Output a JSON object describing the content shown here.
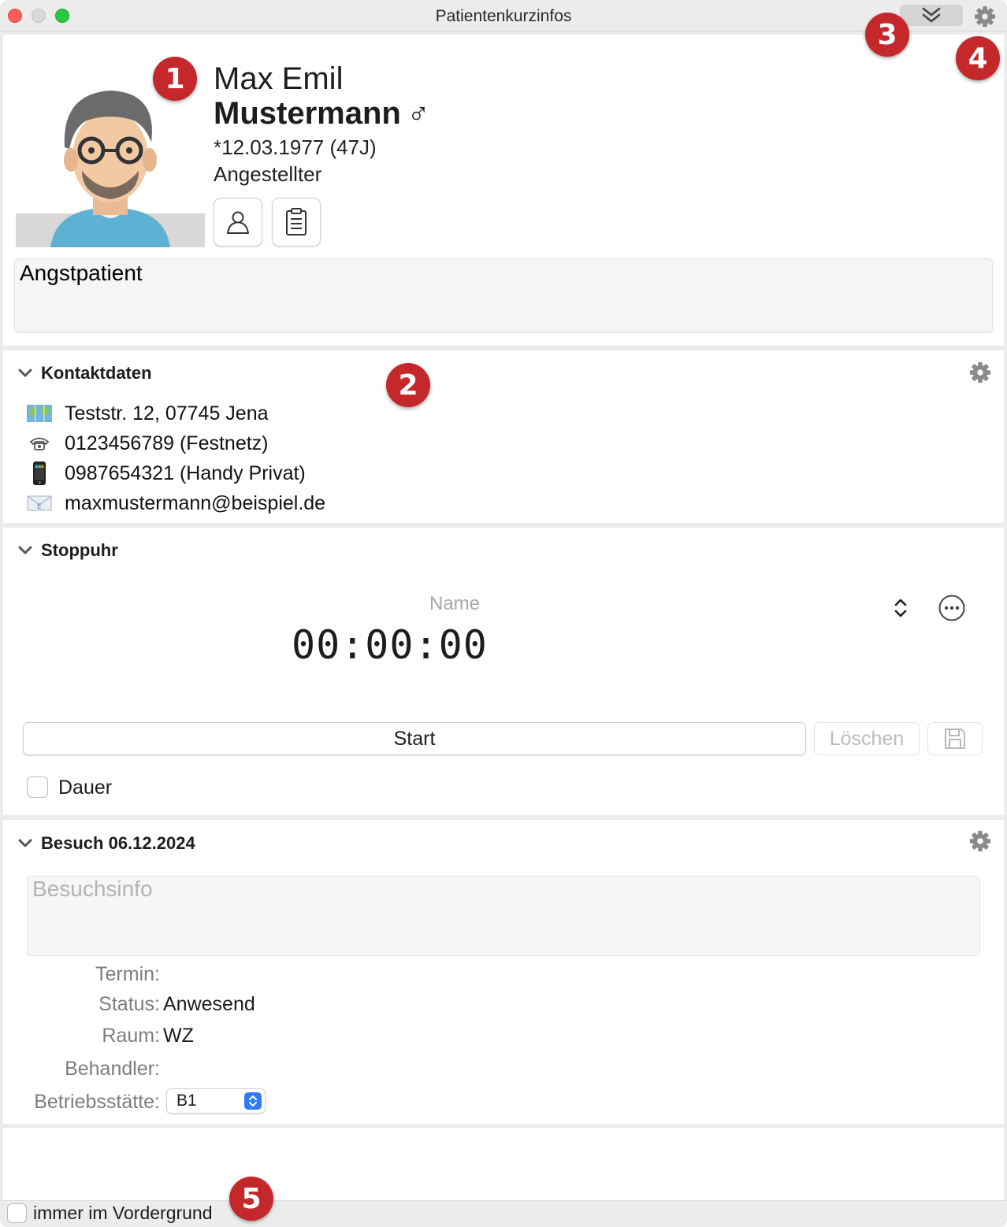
{
  "window": {
    "title": "Patientenkurzinfos"
  },
  "patient": {
    "first_names": "Max Emil",
    "last_name": "Mustermann",
    "gender_symbol": "♂",
    "birth": "*12.03.1977 (47J)",
    "occupation": "Angestellter",
    "note": "Angstpatient"
  },
  "contact": {
    "title": "Kontaktdaten",
    "address": "Teststr. 12, 07745 Jena",
    "phone_landline": "0123456789 (Festnetz)",
    "phone_mobile": "0987654321 (Handy Privat)",
    "email": "maxmustermann@beispiel.de"
  },
  "stopwatch": {
    "title": "Stoppuhr",
    "name_placeholder": "Name",
    "time": "00:00:00",
    "start_label": "Start",
    "delete_label": "Löschen",
    "duration_label": "Dauer"
  },
  "visit": {
    "title": "Besuch 06.12.2024",
    "info_placeholder": "Besuchsinfo",
    "appointment_label": "Termin:",
    "appointment_value": "",
    "status_label": "Status:",
    "status_value": "Anwesend",
    "room_label": "Raum:",
    "room_value": "WZ",
    "practitioner_label": "Behandler:",
    "practitioner_value": "",
    "location_label": "Betriebsstätte:",
    "location_value": "B1"
  },
  "footer": {
    "always_on_top_label": "immer im Vordergrund"
  },
  "callouts": [
    "1",
    "2",
    "3",
    "4",
    "5"
  ],
  "colors": {
    "badge": "#c4282b",
    "accent": "#2f7bf5"
  }
}
